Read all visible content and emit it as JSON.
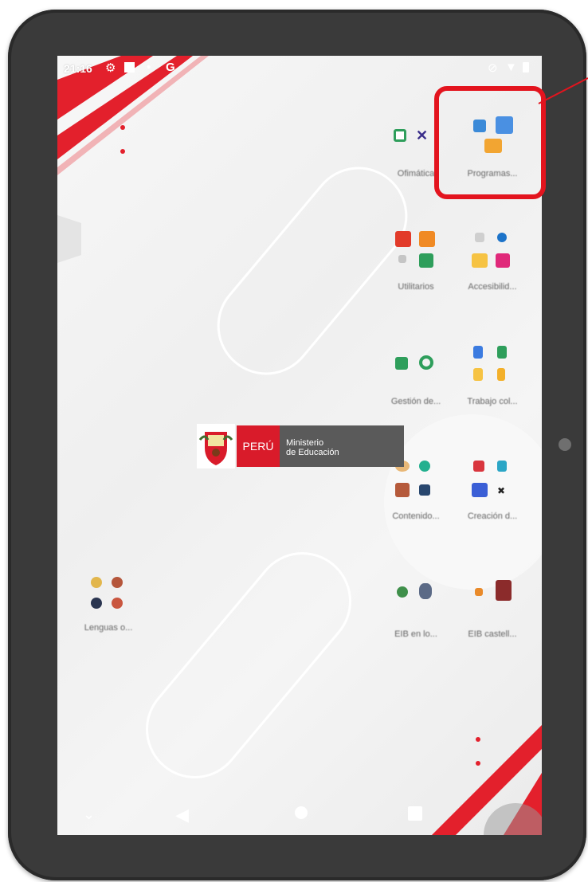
{
  "status_bar": {
    "time": "21:16",
    "left_icons": [
      "gear-icon",
      "square-icon",
      "dot-icon",
      "google-g-icon"
    ],
    "right_icons": [
      "mute-icon",
      "wifi-icon",
      "battery-icon"
    ]
  },
  "folders": [
    {
      "id": "folder-1",
      "label": "Ofimática"
    },
    {
      "id": "folder-2",
      "label": "Programas..."
    },
    {
      "id": "folder-3",
      "label": "Utilitarios"
    },
    {
      "id": "folder-4",
      "label": "Accesibilid..."
    },
    {
      "id": "folder-5",
      "label": "Gestión de..."
    },
    {
      "id": "folder-6",
      "label": "Trabajo col..."
    },
    {
      "id": "folder-7",
      "label": "Contenido..."
    },
    {
      "id": "folder-8",
      "label": "Creación d..."
    },
    {
      "id": "folder-9",
      "label": "Lenguas o..."
    },
    {
      "id": "folder-10",
      "label": "EIB en lo..."
    },
    {
      "id": "folder-11",
      "label": "EIB castell..."
    }
  ],
  "logo": {
    "country": "PERÚ",
    "ministry_line1": "Ministerio",
    "ministry_line2": "de Educación"
  },
  "nav_bar": {
    "buttons": [
      "chevron-down-icon",
      "back-icon",
      "home-icon",
      "recents-icon"
    ]
  },
  "colors": {
    "accent_red": "#e3141e",
    "frame": "#3a3a3a",
    "ministry_gray": "#5a5a5a"
  }
}
